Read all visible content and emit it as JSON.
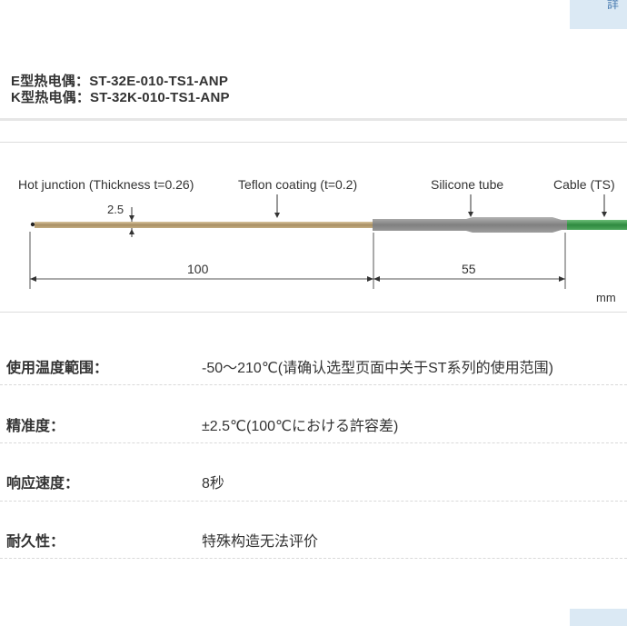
{
  "corner_top_text": "詳",
  "models": {
    "e": "E型热电偶：ST-32E-010-TS1-ANP",
    "k": "K型热电偶：ST-32K-010-TS1-ANP"
  },
  "diagram": {
    "hot_junction": "Hot junction (Thickness t=0.26)",
    "teflon": "Teflon coating (t=0.2)",
    "silicone": "Silicone tube",
    "cable": "Cable (TS)",
    "dim_small": "2.5",
    "dim_100": "100",
    "dim_55": "55",
    "unit": "mm"
  },
  "specs": [
    {
      "label": "使用温度範围：",
      "value": "-50～210℃(请确认选型页面中关于ST系列的使用范围)"
    },
    {
      "label": "精准度：",
      "value": "±2.5℃(100℃における許容差)"
    },
    {
      "label": "响应速度：",
      "value": "8秒"
    },
    {
      "label": "耐久性：",
      "value": "特殊构造无法评价"
    }
  ],
  "colors": {
    "probe": "#b59e74",
    "silicone": "#8c8c8c",
    "cable": "#3f9a4f",
    "corner_button": "#dbe9f4"
  }
}
